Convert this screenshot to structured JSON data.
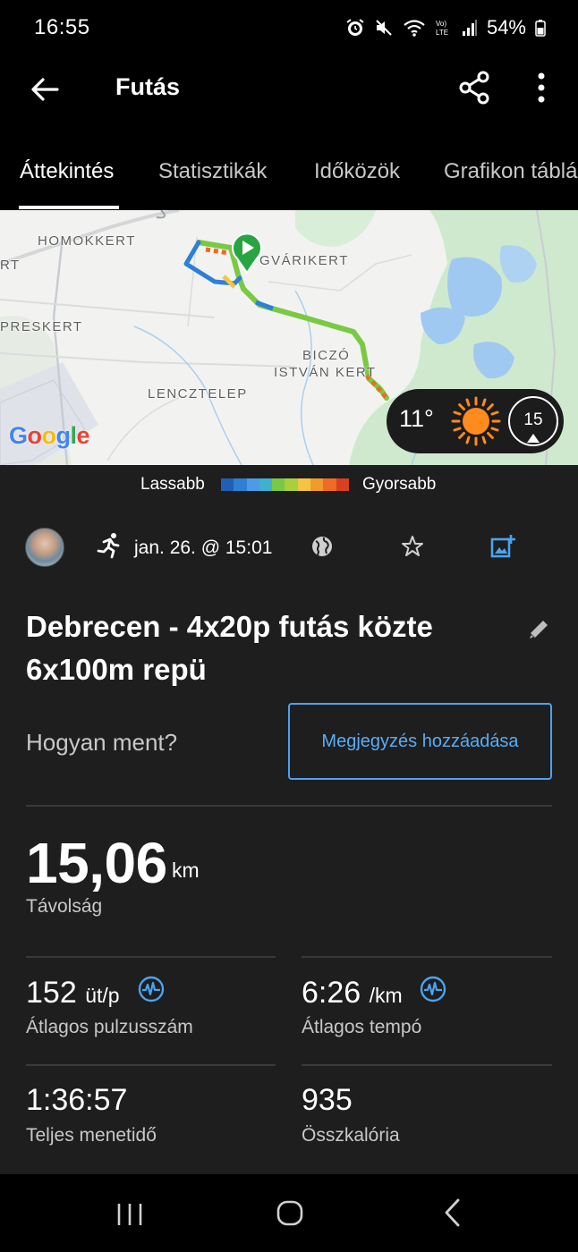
{
  "status_bar": {
    "time": "16:55",
    "battery": "54%",
    "icons": [
      "alarm-icon",
      "mute-icon",
      "wifi-icon",
      "volte-icon",
      "signal-icon",
      "battery-icon"
    ]
  },
  "app_bar": {
    "title": "Futás",
    "icons": [
      "back-arrow-icon",
      "share-icon",
      "more-vert-icon"
    ]
  },
  "tabs": [
    {
      "label": "Áttekintés",
      "active": true
    },
    {
      "label": "Statisztikák",
      "active": false
    },
    {
      "label": "Időközök",
      "active": false
    },
    {
      "label": "Grafikon táblá",
      "active": false
    }
  ],
  "map": {
    "labels": [
      "HOMOKKERT",
      "GVÁRIKERT",
      "RT",
      "PRESKERT",
      "BICZÓ",
      "ISTVÁN KERT",
      "LENCZTELEP"
    ],
    "provider": "Google",
    "weather": {
      "temperature": "11°",
      "condition_icon": "sun-icon",
      "wind": "15"
    }
  },
  "pace_legend": {
    "slower": "Lassabb",
    "faster": "Gyorsabb",
    "colors": [
      "#1f5fb4",
      "#2e7fd6",
      "#4c9be8",
      "#3fb0d0",
      "#7ac943",
      "#a8cf3c",
      "#f4c542",
      "#f29b2a",
      "#ef6a24",
      "#d8401f"
    ]
  },
  "activity": {
    "date": "jan. 26. @ 15:01",
    "title": "Debrecen - 4x20p futás közte 6x100m repü",
    "how_prompt": "Hogyan ment?",
    "add_note": "Megjegyzés hozzáadása"
  },
  "stats": {
    "distance": {
      "value": "15,06",
      "unit": "km",
      "label": "Távolság"
    },
    "avg_hr": {
      "value": "152",
      "unit": "üt/p",
      "label": "Átlagos pulzusszám"
    },
    "avg_pace": {
      "value": "6:26",
      "unit": "/km",
      "label": "Átlagos tempó"
    },
    "total_time": {
      "value": "1:36:57",
      "label": "Teljes menetidő"
    },
    "calories": {
      "value": "935",
      "label": "Összkalória"
    }
  },
  "colors": {
    "accent": "#4aa3f0",
    "background": "#1e1e1e",
    "bar": "#000000"
  }
}
